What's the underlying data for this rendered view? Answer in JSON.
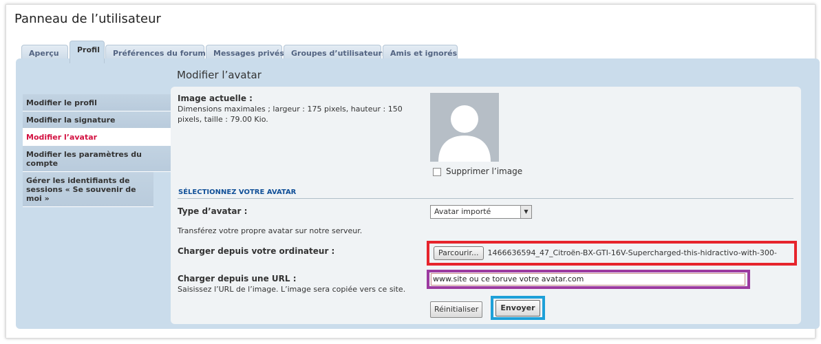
{
  "page": {
    "title": "Panneau de l’utilisateur"
  },
  "tabs": [
    {
      "label": "Aperçu"
    },
    {
      "label": "Profil"
    },
    {
      "label": "Préférences du forum"
    },
    {
      "label": "Messages privés"
    },
    {
      "label": "Groupes d’utilisateurs"
    },
    {
      "label": "Amis et ignorés"
    }
  ],
  "sidebar": {
    "items": [
      {
        "label": "Modifier le profil"
      },
      {
        "label": "Modifier la signature"
      },
      {
        "label": "Modifier l’avatar"
      },
      {
        "label": "Modifier les paramètres du compte"
      },
      {
        "label": "Gérer les identifiants de sessions « Se souvenir de moi »"
      }
    ]
  },
  "content": {
    "title": "Modifier l’avatar",
    "current_image_label": "Image actuelle :",
    "current_image_desc": "Dimensions maximales ; largeur : 175 pixels, hauteur : 150 pixels, taille : 79.00 Kio.",
    "delete_image_label": "Supprimer l’image",
    "section_title": "SÉLECTIONNEZ VOTRE AVATAR",
    "avatar_type_label": "Type d’avatar :",
    "avatar_type_value": "Avatar importé",
    "upload_desc": "Transférez votre propre avatar sur notre serveur.",
    "upload_label": "Charger depuis votre ordinateur :",
    "browse_button": "Parcourir...",
    "file_name": "1466636594_47_Citroën-BX-GTI-16V-Supercharged-this-hidractivo-with-300-",
    "url_label": "Charger depuis une URL :",
    "url_desc": "Saisissez l’URL de l’image. L’image sera copiée vers ce site.",
    "url_value": "www.site ou ce toruve votre avatar.com",
    "reset_button": "Réinitialiser",
    "submit_button": "Envoyer"
  },
  "colors": {
    "panel_bg": "#cadceb",
    "active_menu_text": "#d31141",
    "section_title": "#115098",
    "highlight_file": "#e6242c",
    "highlight_url": "#9c3aa0",
    "highlight_submit": "#1ea0d8"
  }
}
